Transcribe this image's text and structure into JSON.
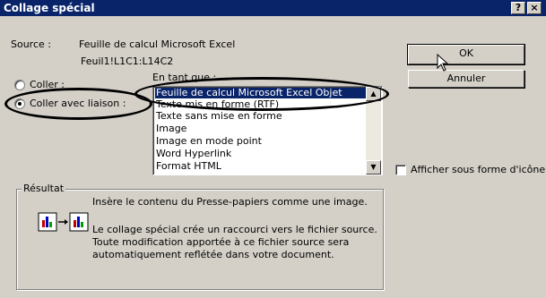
{
  "dialog": {
    "title": "Collage spécial",
    "help_button": "?",
    "close_button": "×"
  },
  "source": {
    "label": "Source :",
    "line1": "Feuille de calcul Microsoft Excel",
    "line2": "Feuil1!L1C1:L14C2"
  },
  "as_label": "En tant que :",
  "options": {
    "paste_label": "Coller :",
    "paste_link_label": "Coller avec liaison :",
    "selected": "Coller avec liaison :"
  },
  "formats": [
    "Feuille de calcul Microsoft Excel Objet",
    "Texte mis en forme (RTF)",
    "Texte sans mise en forme",
    "Image",
    "Image en mode point",
    "Word Hyperlink",
    "Format HTML"
  ],
  "selected_format": "Feuille de calcul Microsoft Excel Objet",
  "buttons": {
    "ok": "OK",
    "cancel": "Annuler"
  },
  "display_as_icon": {
    "label": "Afficher sous forme d'icône",
    "checked": false
  },
  "result": {
    "legend": "Résultat",
    "line1": "Insère le contenu du Presse-papiers comme une image.",
    "para2_line1": "Le collage spécial crée un raccourci vers le fichier source.",
    "para2_line2": "Toute modification apportée à ce fichier source sera",
    "para2_line3": "automatiquement reflétée dans votre document."
  },
  "colors": {
    "titlebar": "#0a246a",
    "dialog_bg": "#d4d0c8",
    "selection": "#0a246a"
  }
}
